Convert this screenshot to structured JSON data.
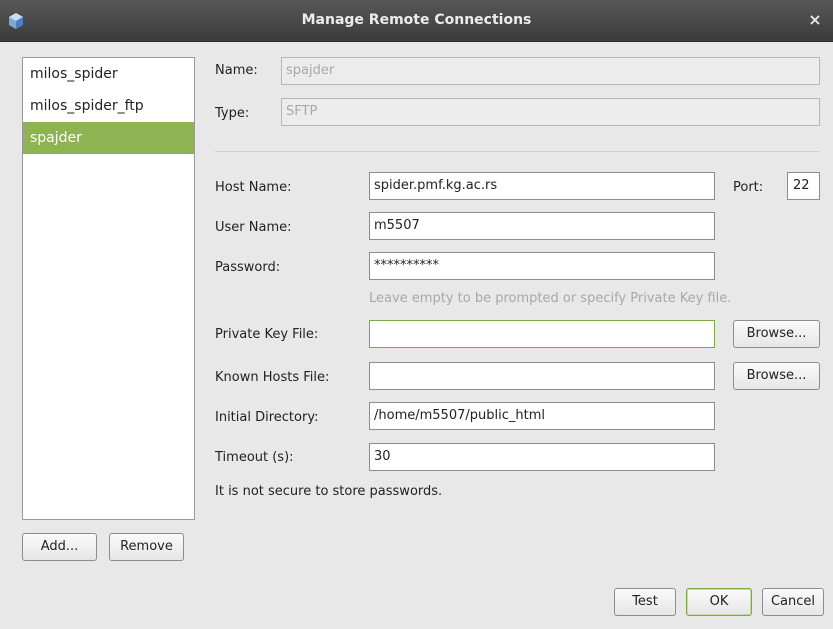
{
  "window": {
    "title": "Manage Remote Connections",
    "close_label": "×",
    "icon": "cube-app-icon"
  },
  "connections": {
    "items": [
      {
        "label": "milos_spider",
        "selected": false
      },
      {
        "label": "milos_spider_ftp",
        "selected": false
      },
      {
        "label": "spajder",
        "selected": true
      }
    ],
    "add_label": "Add...",
    "remove_label": "Remove"
  },
  "form": {
    "name_label": "Name:",
    "name_value": "spajder",
    "type_label": "Type:",
    "type_value": "SFTP",
    "host_label": "Host Name:",
    "host_value": "spider.pmf.kg.ac.rs",
    "port_label": "Port:",
    "port_value": "22",
    "user_label": "User Name:",
    "user_value": "m5507",
    "password_label": "Password:",
    "password_value": "**********",
    "password_hint": "Leave empty to be prompted or specify Private Key file.",
    "private_key_label": "Private Key File:",
    "private_key_value": "",
    "private_key_browse": "Browse...",
    "known_hosts_label": "Known Hosts File:",
    "known_hosts_value": "",
    "known_hosts_browse": "Browse...",
    "initial_dir_label": "Initial Directory:",
    "initial_dir_value": "/home/m5507/public_html",
    "timeout_label": "Timeout (s):",
    "timeout_value": "30",
    "security_note": "It is not secure to store passwords."
  },
  "footer": {
    "test_label": "Test",
    "ok_label": "OK",
    "cancel_label": "Cancel"
  },
  "colors": {
    "selection": "#8eb353",
    "titlebar": "#454545",
    "focus_border": "#7ea845"
  }
}
